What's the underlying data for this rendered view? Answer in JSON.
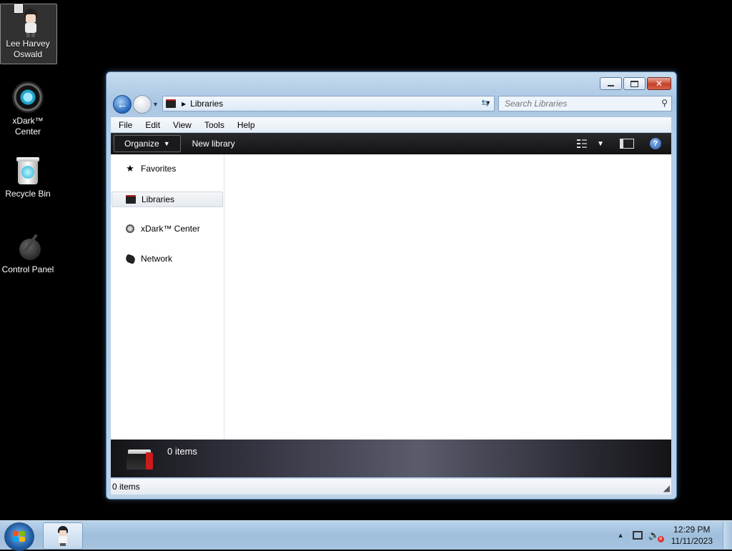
{
  "desktop": {
    "icons": [
      {
        "label": "Lee Harvey Oswald",
        "icon": "user-avatar-icon"
      },
      {
        "label": "xDark™ Center",
        "icon": "xdark-center-icon"
      },
      {
        "label": "Recycle Bin",
        "icon": "recycle-bin-icon"
      },
      {
        "label": "Control Panel",
        "icon": "control-panel-icon"
      }
    ]
  },
  "window": {
    "address": {
      "crumb": "Libraries"
    },
    "search": {
      "placeholder": "Search Libraries"
    },
    "menu": [
      "File",
      "Edit",
      "View",
      "Tools",
      "Help"
    ],
    "toolbar": {
      "organize_label": "Organize",
      "new_library_label": "New library"
    },
    "nav": {
      "items": [
        {
          "label": "Favorites",
          "icon": "star-icon"
        },
        {
          "label": "Libraries",
          "icon": "libraries-icon",
          "selected": true
        },
        {
          "label": "xDark™ Center",
          "icon": "xdark-center-icon"
        },
        {
          "label": "Network",
          "icon": "network-icon"
        }
      ]
    },
    "details": {
      "count": "0 items"
    },
    "status": {
      "text": "0 items"
    }
  },
  "taskbar": {
    "clock": {
      "time": "12:29 PM",
      "date": "11/11/2023"
    }
  },
  "colors": {
    "accent": "#2b6cc1",
    "library_red": "#c81c1c",
    "toolbar_dark": "#1a1a1d"
  }
}
